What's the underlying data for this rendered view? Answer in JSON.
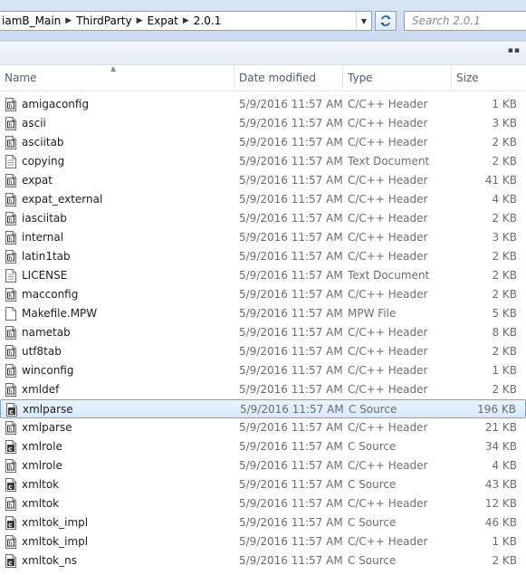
{
  "address_bar": {
    "crumbs": [
      "iamB_Main",
      "ThirdParty",
      "Expat",
      "2.0.1"
    ]
  },
  "search": {
    "placeholder": "Search 2.0.1"
  },
  "columns": {
    "name": "Name",
    "date": "Date modified",
    "type": "Type",
    "size": "Size"
  },
  "files": [
    {
      "name": "amigaconfig",
      "date": "5/9/2016 11:57 AM",
      "type": "C/C++ Header",
      "size": "1 KB",
      "icon": "header-file-icon"
    },
    {
      "name": "ascii",
      "date": "5/9/2016 11:57 AM",
      "type": "C/C++ Header",
      "size": "3 KB",
      "icon": "header-file-icon"
    },
    {
      "name": "asciitab",
      "date": "5/9/2016 11:57 AM",
      "type": "C/C++ Header",
      "size": "2 KB",
      "icon": "header-file-icon"
    },
    {
      "name": "copying",
      "date": "5/9/2016 11:57 AM",
      "type": "Text Document",
      "size": "2 KB",
      "icon": "text-file-icon"
    },
    {
      "name": "expat",
      "date": "5/9/2016 11:57 AM",
      "type": "C/C++ Header",
      "size": "41 KB",
      "icon": "header-file-icon"
    },
    {
      "name": "expat_external",
      "date": "5/9/2016 11:57 AM",
      "type": "C/C++ Header",
      "size": "4 KB",
      "icon": "header-file-icon"
    },
    {
      "name": "iasciitab",
      "date": "5/9/2016 11:57 AM",
      "type": "C/C++ Header",
      "size": "2 KB",
      "icon": "header-file-icon"
    },
    {
      "name": "internal",
      "date": "5/9/2016 11:57 AM",
      "type": "C/C++ Header",
      "size": "3 KB",
      "icon": "header-file-icon"
    },
    {
      "name": "latin1tab",
      "date": "5/9/2016 11:57 AM",
      "type": "C/C++ Header",
      "size": "2 KB",
      "icon": "header-file-icon"
    },
    {
      "name": "LICENSE",
      "date": "5/9/2016 11:57 AM",
      "type": "Text Document",
      "size": "2 KB",
      "icon": "text-file-icon"
    },
    {
      "name": "macconfig",
      "date": "5/9/2016 11:57 AM",
      "type": "C/C++ Header",
      "size": "2 KB",
      "icon": "header-file-icon"
    },
    {
      "name": "Makefile.MPW",
      "date": "5/9/2016 11:57 AM",
      "type": "MPW File",
      "size": "5 KB",
      "icon": "blank-file-icon"
    },
    {
      "name": "nametab",
      "date": "5/9/2016 11:57 AM",
      "type": "C/C++ Header",
      "size": "8 KB",
      "icon": "header-file-icon"
    },
    {
      "name": "utf8tab",
      "date": "5/9/2016 11:57 AM",
      "type": "C/C++ Header",
      "size": "2 KB",
      "icon": "header-file-icon"
    },
    {
      "name": "winconfig",
      "date": "5/9/2016 11:57 AM",
      "type": "C/C++ Header",
      "size": "1 KB",
      "icon": "header-file-icon"
    },
    {
      "name": "xmldef",
      "date": "5/9/2016 11:57 AM",
      "type": "C/C++ Header",
      "size": "2 KB",
      "icon": "header-file-icon"
    },
    {
      "name": "xmlparse",
      "date": "5/9/2016 11:57 AM",
      "type": "C Source",
      "size": "196 KB",
      "icon": "source-file-icon",
      "selected": true
    },
    {
      "name": "xmlparse",
      "date": "5/9/2016 11:57 AM",
      "type": "C/C++ Header",
      "size": "21 KB",
      "icon": "header-file-icon"
    },
    {
      "name": "xmlrole",
      "date": "5/9/2016 11:57 AM",
      "type": "C Source",
      "size": "34 KB",
      "icon": "source-file-icon"
    },
    {
      "name": "xmlrole",
      "date": "5/9/2016 11:57 AM",
      "type": "C/C++ Header",
      "size": "4 KB",
      "icon": "header-file-icon"
    },
    {
      "name": "xmltok",
      "date": "5/9/2016 11:57 AM",
      "type": "C Source",
      "size": "43 KB",
      "icon": "source-file-icon"
    },
    {
      "name": "xmltok",
      "date": "5/9/2016 11:57 AM",
      "type": "C/C++ Header",
      "size": "12 KB",
      "icon": "header-file-icon"
    },
    {
      "name": "xmltok_impl",
      "date": "5/9/2016 11:57 AM",
      "type": "C Source",
      "size": "46 KB",
      "icon": "source-file-icon"
    },
    {
      "name": "xmltok_impl",
      "date": "5/9/2016 11:57 AM",
      "type": "C/C++ Header",
      "size": "1 KB",
      "icon": "header-file-icon"
    },
    {
      "name": "xmltok_ns",
      "date": "5/9/2016 11:57 AM",
      "type": "C Source",
      "size": "2 KB",
      "icon": "source-file-icon"
    }
  ],
  "colors": {
    "selection_border": "#7da2ce",
    "selection_fill": "#d9e9fb",
    "header_text": "#4c607a"
  }
}
